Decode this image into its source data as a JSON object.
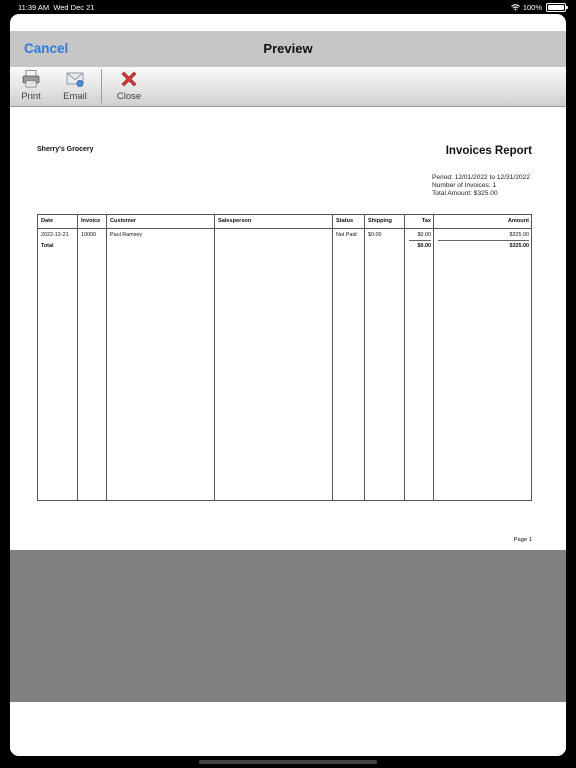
{
  "status_bar": {
    "time": "11:39 AM",
    "date": "Wed Dec 21",
    "battery": "100%"
  },
  "nav": {
    "cancel_label": "Cancel",
    "title": "Preview"
  },
  "toolbar": {
    "print_label": "Print",
    "email_label": "Email",
    "close_label": "Close"
  },
  "report": {
    "store_name": "Sherry's Grocery",
    "title": "Invoices Report",
    "period": "Period: 12/01/2022 to 12/31/2022",
    "num_invoices": "Number of Invoices: 1",
    "total_amount": "Total Amount: $325.00",
    "columns": [
      "Date",
      "Invoice",
      "Customer",
      "Salesperson",
      "Status",
      "Shipping",
      "Tax",
      "Amount"
    ],
    "rows": [
      {
        "date": "2022-12-21",
        "invoice": "10000",
        "customer": "Paul Ramsey",
        "salesperson": "",
        "status": "Not Paid",
        "shipping": "$0.00",
        "tax": "$0.00",
        "amount": "$325.00"
      }
    ],
    "total": {
      "label": "Total",
      "tax": "$0.00",
      "amount": "$325.00"
    },
    "page_label": "Page 1"
  },
  "colors": {
    "accent": "#2f7bd8",
    "close_icon": "#d23a3a",
    "nav_bg": "#c6c6c6",
    "gray_area": "#808080"
  }
}
